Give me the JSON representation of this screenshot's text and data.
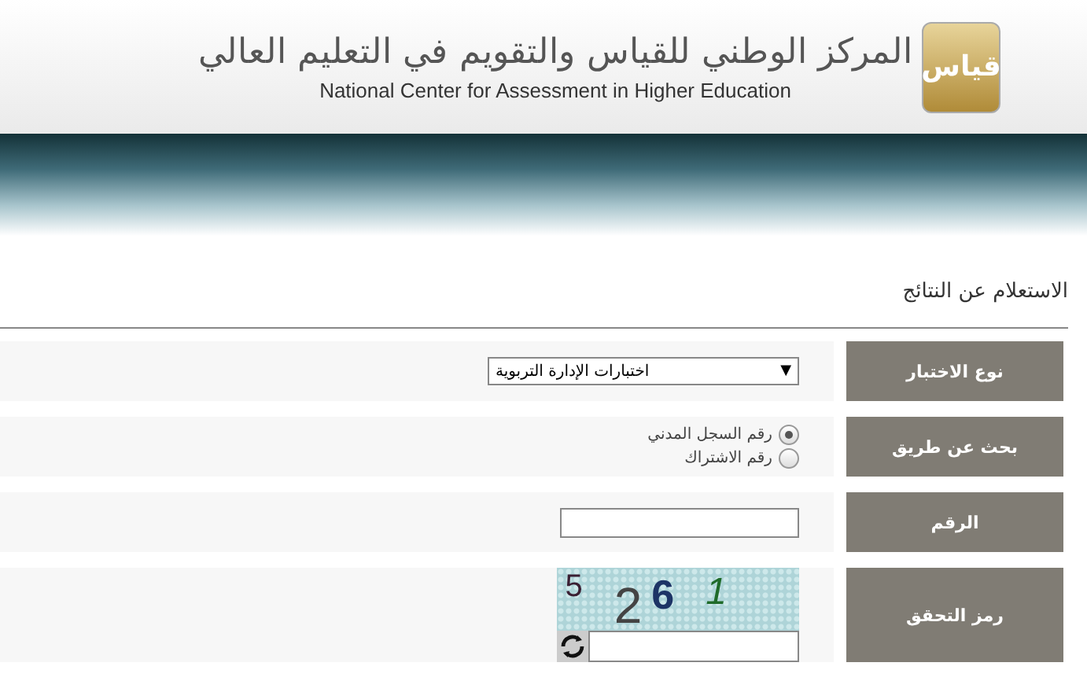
{
  "header": {
    "logo_text": "قياس",
    "title_ar": "المركز الوطني للقياس والتقويم في التعليم العالي",
    "title_en": "National Center for Assessment in Higher Education"
  },
  "page_title": "الاستعلام عن النتائج",
  "form": [
    {
      "kind": "select",
      "label": "نوع الاختبار",
      "value": "اختبارات الإدارة التربوية",
      "arrow": "▼"
    },
    {
      "kind": "radio",
      "label": "بحث عن طريق",
      "options": [
        {
          "label": "رقم السجل المدني",
          "selected": true
        },
        {
          "label": "رقم الاشتراك",
          "selected": false
        }
      ]
    },
    {
      "kind": "text",
      "label": "الرقم"
    },
    {
      "kind": "captcha",
      "label": "رمز التحقق",
      "digits": [
        {
          "text": "1",
          "color": "#1f6b2a"
        },
        {
          "text": "6",
          "color": "#1d3466"
        },
        {
          "text": "2",
          "color": "#444444"
        },
        {
          "text": "5",
          "color": "#3a1f33"
        }
      ]
    }
  ]
}
